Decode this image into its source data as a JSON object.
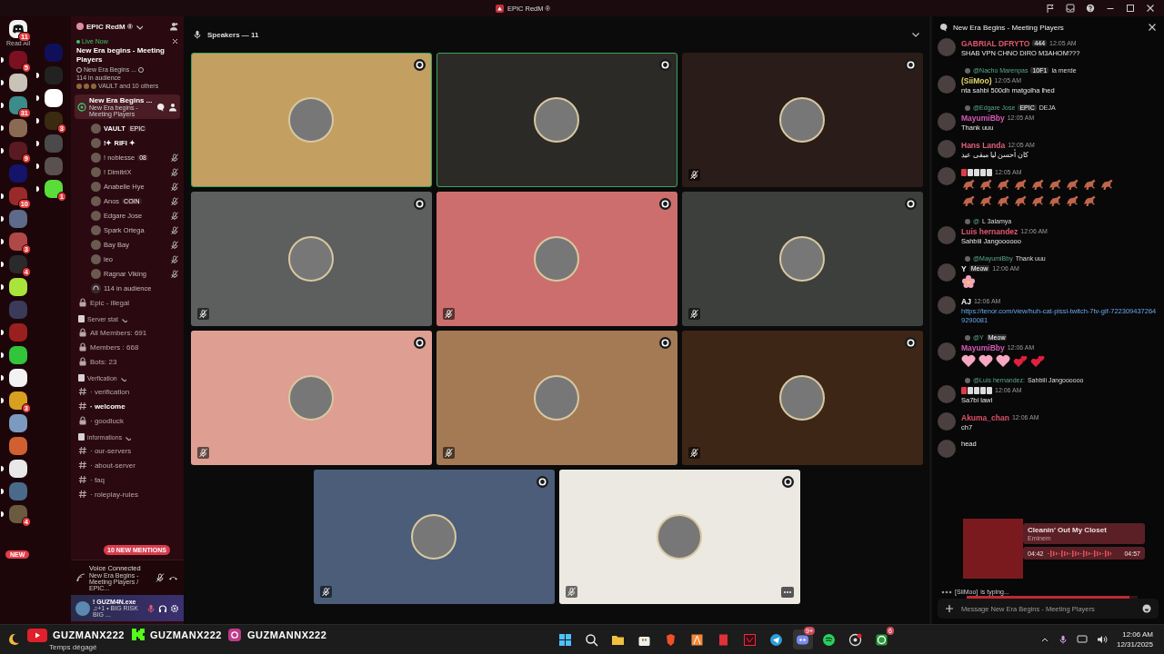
{
  "title_bar": {
    "title": "EPIC RedM ®"
  },
  "server_rail": {
    "home_badge": "11",
    "read_all": "Read All",
    "new_pill": "NEW",
    "servers": [
      {
        "badge": "5",
        "unread": true
      },
      {
        "unread": true
      },
      {
        "badge": "31",
        "unread": true
      },
      {
        "unread": true
      },
      {
        "badge": "9",
        "unread": true
      },
      {
        "unread": false
      },
      {
        "badge": "10",
        "unread": true
      },
      {
        "unread": true
      },
      {
        "badge": "3",
        "unread": true
      },
      {
        "badge": "4",
        "unread": true
      },
      {
        "unread": true
      },
      {
        "unread": false
      },
      {
        "unread": true
      },
      {
        "unread": true
      },
      {
        "unread": true
      },
      {
        "badge": "3",
        "unread": true
      },
      {
        "unread": false
      },
      {
        "unread": false
      },
      {
        "unread": true
      },
      {
        "unread": true
      },
      {
        "badge": "4",
        "unread": true
      }
    ],
    "folder": [
      {
        "unread": false
      },
      {
        "unread": true
      },
      {
        "unread": true
      },
      {
        "badge": "3",
        "unread": true
      },
      {
        "unread": true
      },
      {
        "unread": true
      },
      {
        "badge": "1",
        "unread": true
      }
    ]
  },
  "sidebar": {
    "server_name": "EPIC RedM ®",
    "live": {
      "label": "Live Now",
      "title": "New Era begins - Meeting Players",
      "stage_name": "New Era Begins ...",
      "audience": "114 in audience",
      "speakers": "VAULT and 10 others"
    },
    "stage_channel": {
      "name": "New Era Begins ...",
      "topic": "New Era begins - Meeting Players",
      "selected": true
    },
    "participants": [
      {
        "name": "VAULT",
        "tag": "EPIC",
        "muted": false
      },
      {
        "name": "!✦ RIFI ✦",
        "muted": false
      },
      {
        "name": "! noblesse",
        "tag": "08",
        "muted": true
      },
      {
        "name": "! DimitriX",
        "muted": true
      },
      {
        "name": "Anabelle Hye",
        "muted": true
      },
      {
        "name": "Anos",
        "tag": "COIN",
        "muted": true
      },
      {
        "name": "Edgare Jose",
        "muted": true
      },
      {
        "name": "Spark Ortega",
        "muted": true
      },
      {
        "name": "Bay Bay",
        "muted": true
      },
      {
        "name": "leo",
        "muted": true
      },
      {
        "name": "Ragnar Viking",
        "muted": true
      }
    ],
    "audience": "114 in audience",
    "channels": [
      {
        "kind": "locked",
        "name": "Epic - illegal",
        "unread": false
      },
      {
        "kind": "category",
        "name": "Server stat"
      },
      {
        "kind": "locked",
        "name": "All Members: 691",
        "unread": false
      },
      {
        "kind": "locked",
        "name": "Members : 668",
        "unread": false
      },
      {
        "kind": "locked",
        "name": "Bots: 23",
        "unread": false
      },
      {
        "kind": "category",
        "name": "Verfication"
      },
      {
        "kind": "text",
        "name": "· verification",
        "unread": false
      },
      {
        "kind": "text",
        "name": "· welcome",
        "unread": true
      },
      {
        "kind": "locked",
        "name": "· goodluck",
        "unread": false
      },
      {
        "kind": "category",
        "name": "informations"
      },
      {
        "kind": "text",
        "name": "· our-servers",
        "unread": false
      },
      {
        "kind": "text",
        "name": "· about-server",
        "unread": false
      },
      {
        "kind": "text",
        "name": "· faq",
        "unread": false
      },
      {
        "kind": "text",
        "name": "· roleplay-rules",
        "unread": false
      }
    ],
    "mentions_pill": "10 NEW MENTIONS"
  },
  "voice": {
    "status": "Voice Connected",
    "channel": "New Era Begins - Meeting Players / EPIC..."
  },
  "user": {
    "name": "! GUZM4N.exe",
    "activity": "♫+1 • BIG RISK BIG ..."
  },
  "stage": {
    "title": "Speakers — 11",
    "tiles": [
      {
        "color": "#c49f62",
        "speaking": true,
        "muted": false,
        "has_menu": false
      },
      {
        "color": "#2c2a27",
        "speaking": true,
        "muted": false,
        "has_menu": false
      },
      {
        "color": "#2a1c18",
        "speaking": false,
        "muted": true,
        "has_menu": false
      },
      {
        "color": "#5d5e5e",
        "speaking": false,
        "muted": true,
        "has_menu": false
      },
      {
        "color": "#cc6e6e",
        "speaking": false,
        "muted": true,
        "has_menu": false
      },
      {
        "color": "#3d3f3c",
        "speaking": false,
        "muted": true,
        "has_menu": false
      },
      {
        "color": "#de9e92",
        "speaking": false,
        "muted": true,
        "has_menu": false
      },
      {
        "color": "#a47a55",
        "speaking": false,
        "muted": true,
        "has_menu": false
      },
      {
        "color": "#3e2617",
        "speaking": false,
        "muted": true,
        "has_menu": false
      },
      {
        "color": "#4b5d78",
        "speaking": false,
        "muted": true,
        "has_menu": false
      },
      {
        "color": "#ebe9e1",
        "speaking": false,
        "muted": true,
        "has_menu": true
      }
    ]
  },
  "chat": {
    "title": "New Era Begins - Meeting Players",
    "messages": [
      {
        "author": "GABRIAL DFRYTO",
        "color": "#e2566f",
        "tag": "444",
        "time": "12:05 AM",
        "kind": "text",
        "text": "SHAB VPN CHNO DIRO M3AHOM???"
      },
      {
        "reply": {
          "to": "@Nacho Marenpas",
          "tag": "10F1",
          "text": "la merde"
        },
        "author": "(SiiMoo)",
        "color": "#e3d36a",
        "time": "12:05 AM",
        "kind": "text",
        "text": "nta sahbi 500dh matgolha lhed"
      },
      {
        "reply": {
          "to": "@Edgare Jose",
          "tag": "EPIC",
          "text": "DEJA"
        },
        "author": "MayumiBby",
        "color": "#d65bb8",
        "time": "12:05 AM",
        "kind": "text",
        "text": "Thank uuu"
      },
      {
        "author": "Hans Landa",
        "color": "#e0607a",
        "time": "12:05 AM",
        "kind": "text",
        "text": "كان أحسن ليا مبقى عيد"
      },
      {
        "time": "12:05 AM",
        "kind": "emoji",
        "emoji": [
          {
            "kind": "horse"
          },
          {
            "kind": "horse"
          },
          {
            "kind": "horse"
          },
          {
            "kind": "horse"
          },
          {
            "kind": "horse"
          },
          {
            "kind": "horse"
          },
          {
            "kind": "horse"
          },
          {
            "kind": "horse"
          },
          {
            "kind": "horse"
          },
          {
            "kind": "horse"
          },
          {
            "kind": "horse"
          },
          {
            "kind": "horse"
          },
          {
            "kind": "horse"
          },
          {
            "kind": "horse"
          },
          {
            "kind": "horse"
          },
          {
            "kind": "horse"
          },
          {
            "kind": "horse"
          }
        ]
      },
      {
        "reply": {
          "to": "@",
          "text": "L 3alamya"
        },
        "author": "Luis hernandez",
        "color": "#e2566f",
        "time": "12:06 AM",
        "kind": "text",
        "text": "Sahbiii Jangoooooo"
      },
      {
        "reply": {
          "to": "@MayumiBby",
          "text": "Thank uuu"
        },
        "author": "Y",
        "tag": "Meow",
        "time": "12:06 AM",
        "kind": "emoji",
        "emoji": [
          {
            "kind": "flower"
          }
        ]
      },
      {
        "author": "AJ",
        "time": "12:06 AM",
        "kind": "link",
        "text": "https://tenor.com/view/huh-cat-pissi-twitch-7tv-gif-7223094372649290081"
      },
      {
        "reply": {
          "to": "@Y",
          "tag": "Meow"
        },
        "author": "MayumiBby",
        "color": "#d65bb8",
        "time": "12:06 AM",
        "kind": "emoji",
        "emoji": [
          {
            "kind": "heart"
          },
          {
            "kind": "heart"
          },
          {
            "kind": "heart"
          },
          {
            "kind": "hearts"
          },
          {
            "kind": "hearts"
          }
        ]
      },
      {
        "reply": {
          "to": "@Luis hernandez:",
          "text": "Sahbiii Jangoooooo"
        },
        "time": "12:06 AM",
        "kind": "text",
        "text": "Sa7bi lawl"
      },
      {
        "author": "Akuma_chan",
        "color": "#e0506a",
        "time": "12:06 AM",
        "kind": "text",
        "text": "ch7"
      },
      {
        "kind": "text",
        "text": "head"
      }
    ],
    "typing": {
      "name": "[SiiMoo]",
      "text": "is typing..."
    },
    "placeholder": "Message New Era Begins - Meeting Players",
    "now_playing": {
      "title": "Cleanin' Out My Closet",
      "artist": "Eminem",
      "elapsed": "04:42",
      "total": "04:57",
      "level": 0.95
    }
  },
  "taskbar": {
    "weather": "Temps dégagé",
    "socials": [
      {
        "kind": "youtube",
        "handle": "GUZMANX222"
      },
      {
        "kind": "kick",
        "handle": "GUZMANX222"
      },
      {
        "kind": "instagram",
        "handle": "GUZMANNX222"
      }
    ],
    "apps": [
      {
        "kind": "windows",
        "active": false
      },
      {
        "kind": "search",
        "active": false
      },
      {
        "kind": "folder",
        "active": false
      },
      {
        "kind": "store",
        "active": false
      },
      {
        "kind": "brave",
        "active": false
      },
      {
        "kind": "launcher",
        "active": false
      },
      {
        "kind": "notes",
        "active": false
      },
      {
        "kind": "valorant",
        "active": false
      },
      {
        "kind": "telegram",
        "active": false
      },
      {
        "kind": "discord",
        "badge": "9+",
        "active": true
      },
      {
        "kind": "spotify",
        "active": false
      },
      {
        "kind": "obs",
        "active": false
      },
      {
        "kind": "xbox",
        "badge": "6",
        "active": false
      }
    ],
    "time": "12:06 AM",
    "date": "12/31/2025"
  }
}
